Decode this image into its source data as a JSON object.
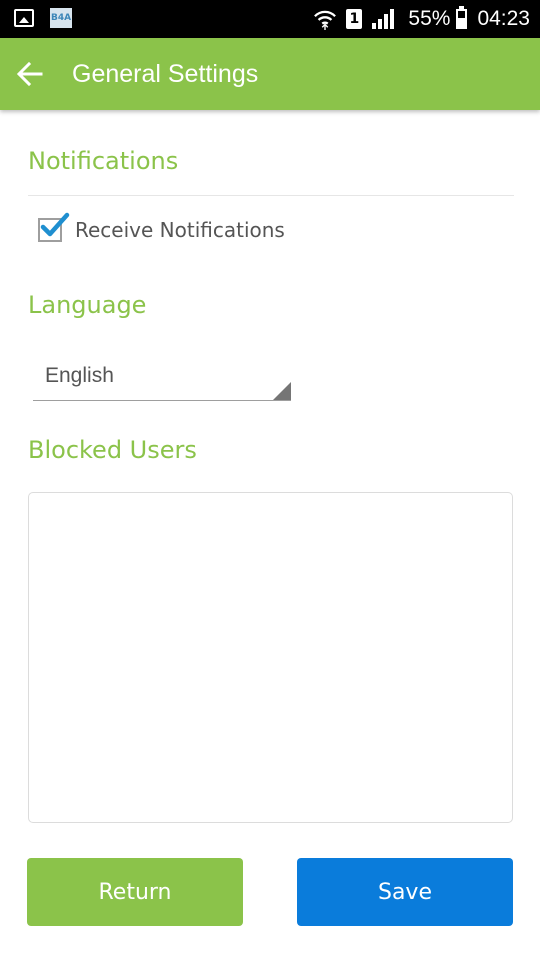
{
  "status_bar": {
    "app_badge": "B4A",
    "sim_slot": "1",
    "battery_percent": "55%",
    "time": "04:23"
  },
  "toolbar": {
    "title": "General Settings",
    "color": "#8bc34a"
  },
  "notifications": {
    "heading": "Notifications",
    "checkbox_label": "Receive Notifications",
    "checked": true
  },
  "language": {
    "heading": "Language",
    "selected": "English"
  },
  "blocked_users": {
    "heading": "Blocked Users",
    "items": []
  },
  "buttons": {
    "return_label": "Return",
    "save_label": "Save",
    "return_color": "#8bc34a",
    "save_color": "#0a7cdb"
  }
}
